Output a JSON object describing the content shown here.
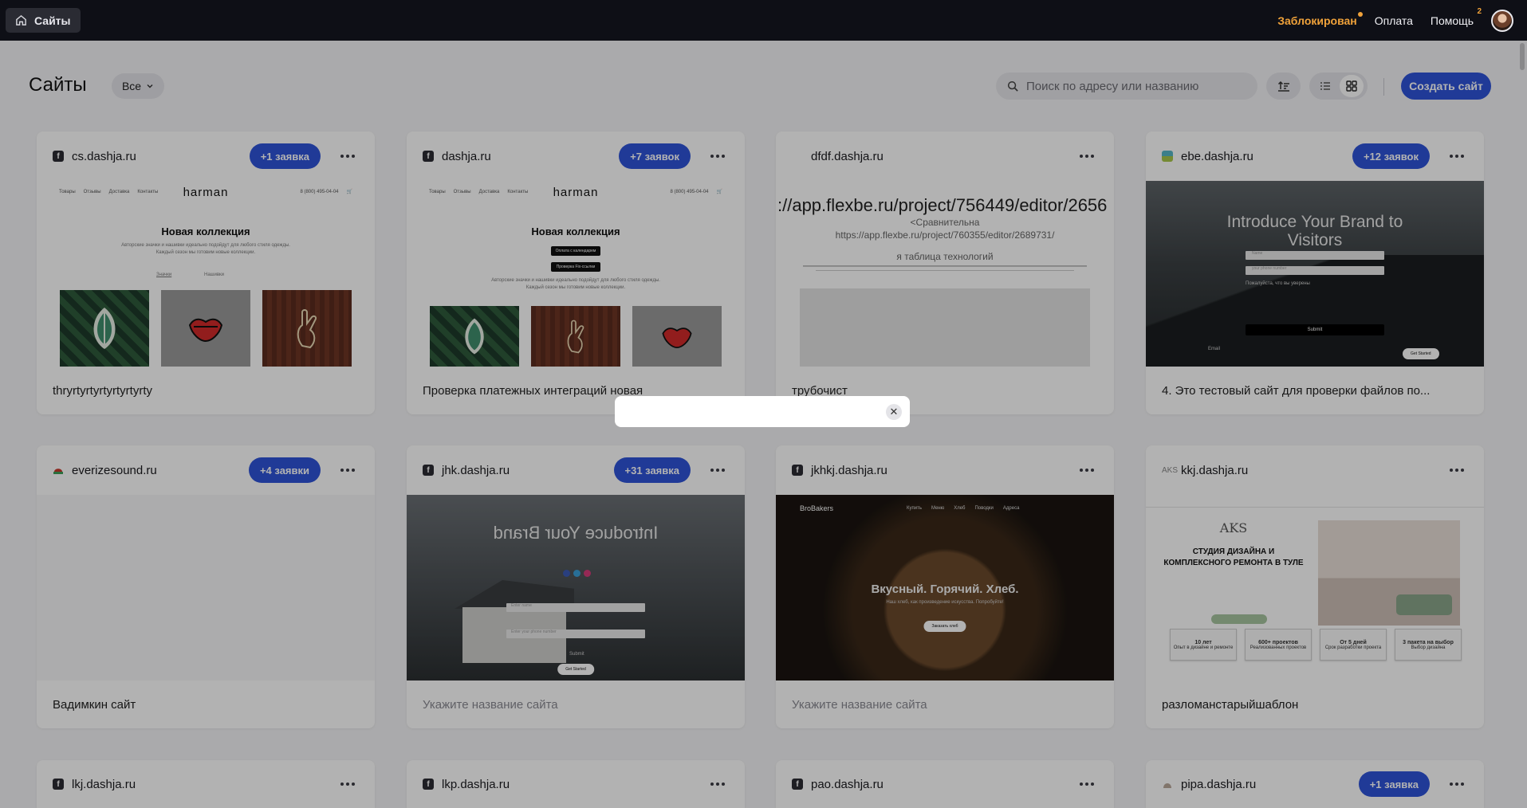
{
  "topbar": {
    "sites_label": "Сайты",
    "blocked_label": "Заблокирован",
    "payment_label": "Оплата",
    "help_label": "Помощь",
    "help_badge": "2"
  },
  "toolbar": {
    "title": "Сайты",
    "filter_label": "Все",
    "search_placeholder": "Поиск по адресу или названию",
    "create_label": "Создать сайт"
  },
  "cards": [
    {
      "domain": "cs.dashja.ru",
      "fav": "f",
      "badge": "+1 заявка",
      "name": "thryrtyrtyrtyrtyrtyrty"
    },
    {
      "domain": "dashja.ru",
      "fav": "f",
      "badge": "+7 заявок",
      "name": "Проверка платежных интеграций новая"
    },
    {
      "domain": "dfdf.dashja.ru",
      "fav": "",
      "badge": "",
      "name": "трубочист"
    },
    {
      "domain": "ebe.dashja.ru",
      "fav": "",
      "badge": "+12 заявок",
      "name": "4. Это тестовый сайт для проверки файлов по..."
    },
    {
      "domain": "everizesound.ru",
      "fav": "",
      "badge": "+4 заявки",
      "name": "Вадимкин сайт"
    },
    {
      "domain": "jhk.dashja.ru",
      "fav": "f",
      "badge": "+31 заявка",
      "name": "Укажите название сайта"
    },
    {
      "domain": "jkhkj.dashja.ru",
      "fav": "f",
      "badge": "",
      "name": "Укажите название сайта"
    },
    {
      "domain": "kkj.dashja.ru",
      "fav": "",
      "badge": "",
      "name": "разломанстарыйшаблон"
    },
    {
      "domain": "lkj.dashja.ru",
      "fav": "f",
      "badge": ""
    },
    {
      "domain": "lkp.dashja.ru",
      "fav": "f",
      "badge": ""
    },
    {
      "domain": "pao.dashja.ru",
      "fav": "f",
      "badge": ""
    },
    {
      "domain": "pipa.dashja.ru",
      "fav": "",
      "badge": "+1 заявка"
    }
  ],
  "previews": {
    "harman": {
      "logo": "harman",
      "nav": [
        "Товары",
        "Отзывы",
        "Доставка",
        "Контакты"
      ],
      "phone": "8 (800) 495-04-04",
      "heading": "Новая коллекция",
      "text1": "Авторские значки и нашивки идеально подойдут для любого стиля одежды.",
      "text2": "Каждый сезон мы готовим новые коллекции.",
      "tab1": "Значки",
      "tab2": "Нашивки",
      "btn1": "Оплата с календарем",
      "btn2": "Проверка Fix-ссылки"
    },
    "dfdf": {
      "url": "://app.flexbe.ru/project/756449/editor/2656",
      "line1": "<Сравнительна",
      "line2": "https://app.flexbe.ru/project/760355/editor/2689731/",
      "line3": "я таблица технологий"
    },
    "ebe": {
      "title": "Introduce Your Brand to Visitors",
      "name_ph": "Name",
      "phone_ph": "your phone number",
      "agree": "Пожалуйста, что вы уверены",
      "submit": "Submit",
      "email": "Email",
      "get_started": "Get Started"
    },
    "jhk": {
      "title": "Introduce Your Brand",
      "name_ph": "Enter name",
      "phone_ph": "Enter your phone number",
      "submit": "Submit",
      "get_started": "Get Started"
    },
    "bread": {
      "logo": "BroBakers",
      "nav": [
        "Купить",
        "Меню",
        "Хлеб",
        "Поводки",
        "Адреса"
      ],
      "title": "Вкусный. Горячий. Хлеб.",
      "sub": "Наш хлеб, как произведение искусства. Попробуйте!",
      "cta": "Заказать хлеб"
    },
    "design": {
      "logo": "AKS",
      "title": "СТУДИЯ ДИЗАЙНА И КОМПЛЕКСНОГО РЕМОНТА В ТУЛЕ",
      "stats": [
        {
          "v": "10 лет",
          "t": "Опыт в дизайне и ремонте"
        },
        {
          "v": "600+ проектов",
          "t": "Реализованных проектов"
        },
        {
          "v": "От 5 дней",
          "t": "Срок разработки проекта"
        },
        {
          "v": "3 пакета на выбор",
          "t": "Выбор дизайна"
        }
      ]
    }
  }
}
